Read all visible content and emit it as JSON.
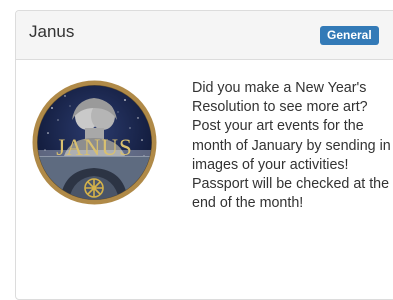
{
  "card": {
    "title": "Janus",
    "badge": "General",
    "image": {
      "alt_icon": "janus-logo",
      "logo_text": "JANUS",
      "colors": {
        "ring": "#b08a48",
        "sky": "#16213f"
      }
    },
    "description": "Did you make a New Year's Resolution to see more art? Post your art events for the month of January by sending in images of your activities! Passport will be checked at the end of the month!"
  },
  "colors": {
    "badge_bg": "#337ab7",
    "header_bg": "#f5f5f5",
    "text": "#333333"
  }
}
